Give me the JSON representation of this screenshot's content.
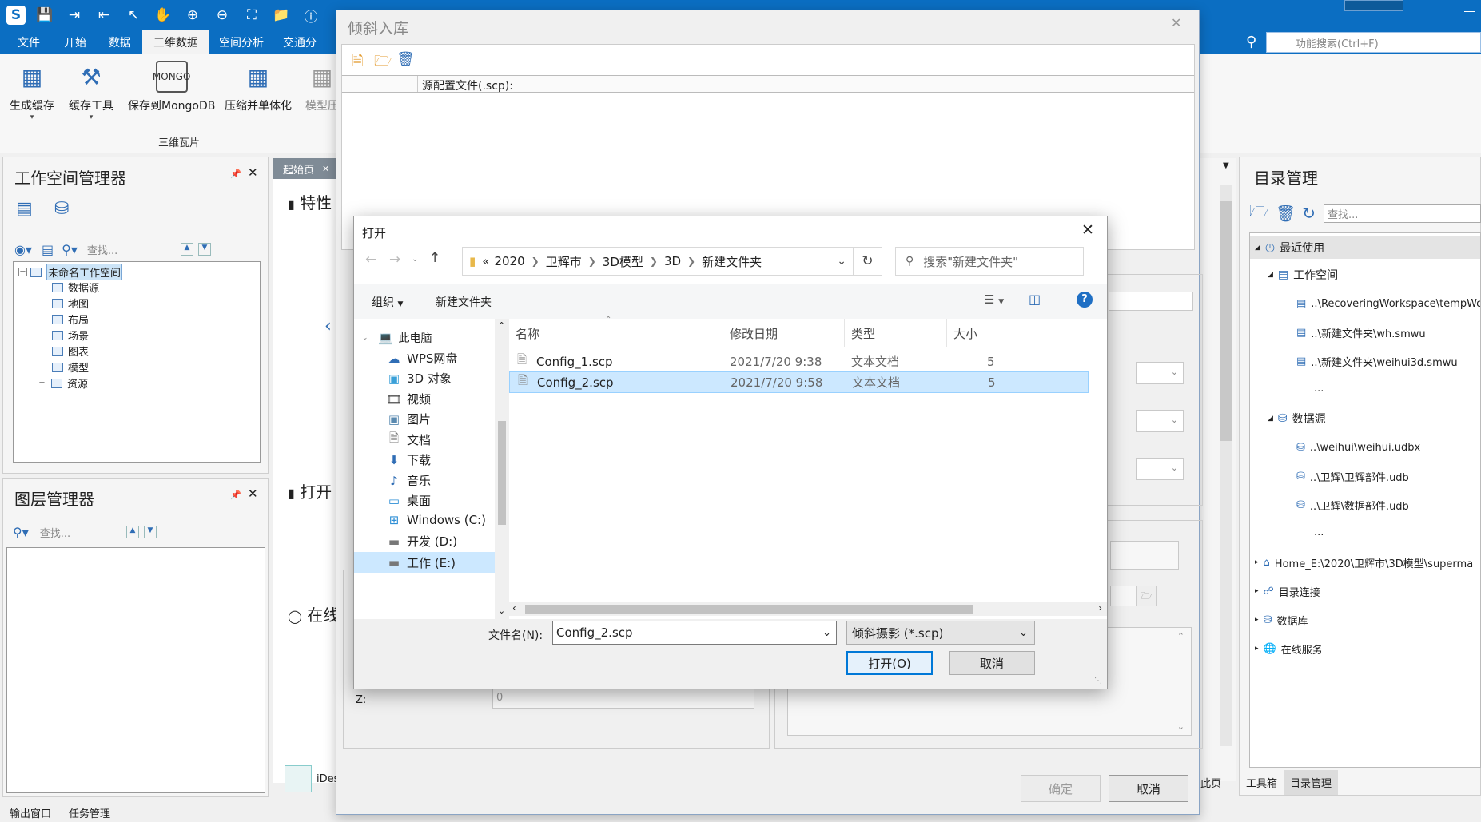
{
  "app": {
    "menu_tabs": [
      "文件",
      "开始",
      "数据",
      "三维数据",
      "空间分析",
      "交通分"
    ],
    "active_tab": "三维数据",
    "search_placeholder": "功能搜索(Ctrl+F)",
    "ribbon": {
      "buttons": [
        "生成缓存",
        "缓存工具",
        "保存到MongoDB",
        "压缩并单体化",
        "模型压"
      ],
      "group_label": "三维瓦片"
    },
    "workspace_panel": {
      "title": "工作空间管理器",
      "search_placeholder": "查找...",
      "root": "未命名工作空间",
      "items": [
        "数据源",
        "地图",
        "布局",
        "场景",
        "图表",
        "模型",
        "资源"
      ]
    },
    "layer_panel": {
      "title": "图层管理器",
      "search_placeholder": "查找..."
    },
    "start_tab": {
      "label": "起始页",
      "sections": [
        "特性",
        "打开",
        "在线"
      ],
      "ides_label": "iDes"
    },
    "catalog_panel": {
      "title": "目录管理",
      "search_placeholder": "查找...",
      "recent": "最近使用",
      "workspace": "工作空间",
      "ws_items": [
        "..\\RecoveringWorkspace\\tempWor",
        "..\\新建文件夹\\wh.smwu",
        "..\\新建文件夹\\weihui3d.smwu",
        "..."
      ],
      "datasource": "数据源",
      "ds_items": [
        "..\\weihui\\weihui.udbx",
        "..\\卫辉\\卫辉部件.udb",
        "..\\卫辉\\数据部件.udb",
        "..."
      ],
      "others": [
        "Home_E:\\2020\\卫辉市\\3D模型\\superma",
        "目录连接",
        "数据库",
        "在线服务"
      ],
      "bottom_tabs": [
        "工具箱",
        "目录管理"
      ]
    },
    "status_tabs": [
      "输出窗口",
      "任务管理"
    ],
    "colors": {
      "accent": "#0b6ec2",
      "selection": "#cce4f7",
      "dialog_selection": "#cce8ff"
    }
  },
  "tilt_dialog": {
    "title": "倾斜入库",
    "header_col": "源配置文件(.scp):",
    "z_label": "Z:",
    "z_value": "0",
    "ok": "确定",
    "cancel": "取消",
    "last_page": "此页"
  },
  "open_dialog": {
    "title": "打开",
    "breadcrumb": [
      "2020",
      "卫辉市",
      "3D模型",
      "3D",
      "新建文件夹"
    ],
    "breadcrumb_prefix": "«",
    "search_placeholder": "搜索\"新建文件夹\"",
    "organize": "组织",
    "new_folder": "新建文件夹",
    "nav": [
      "此电脑",
      "WPS网盘",
      "3D 对象",
      "视频",
      "图片",
      "文档",
      "下载",
      "音乐",
      "桌面",
      "Windows (C:)",
      "开发 (D:)",
      "工作 (E:)"
    ],
    "columns": [
      "名称",
      "修改日期",
      "类型",
      "大小"
    ],
    "files": [
      {
        "name": "Config_1.scp",
        "date": "2021/7/20 9:38",
        "type": "文本文档",
        "size": "5"
      },
      {
        "name": "Config_2.scp",
        "date": "2021/7/20 9:58",
        "type": "文本文档",
        "size": "5"
      }
    ],
    "filename_label": "文件名(N):",
    "filename_value": "Config_2.scp",
    "filter": "倾斜摄影 (*.scp)",
    "open_btn": "打开(O)",
    "cancel_btn": "取消"
  }
}
